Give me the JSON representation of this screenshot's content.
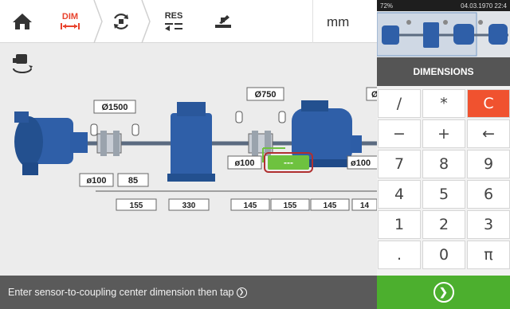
{
  "toolbar": {
    "home_icon": "home-icon",
    "dim_label": "DIM",
    "rotate_icon": "rotate-measure-icon",
    "res_label": "RES",
    "align_icon": "machine-move-icon",
    "unit": "mm",
    "accent": "#e8432d"
  },
  "side": {
    "icon": "machine-settings-icon"
  },
  "diagram": {
    "dims": {
      "d1500": "Ø1500",
      "d750": "Ø750",
      "d_cut": "Ø",
      "d100_a": "ø100",
      "d100_b": "ø100",
      "d100_c": "ø100",
      "v85": "85",
      "v155_a": "155",
      "v330": "330",
      "v145_a": "145",
      "v155_b": "155",
      "v145_b": "145",
      "v14": "14",
      "active_field": "---"
    },
    "active_color": "#6ec23f"
  },
  "status": {
    "message": "Enter sensor-to-coupling center dimension then tap"
  },
  "panel": {
    "statusbar": {
      "battery": "72%",
      "datetime": "04.03.1970 22:4"
    },
    "header": "DIMENSIONS",
    "keys": [
      "/",
      "*",
      "C",
      "−",
      "+",
      "←",
      "7",
      "8",
      "9",
      "4",
      "5",
      "6",
      "1",
      "2",
      "3",
      ".",
      "0",
      "π"
    ],
    "clear_color": "#f0522f",
    "go_color": "#4caf2e"
  }
}
